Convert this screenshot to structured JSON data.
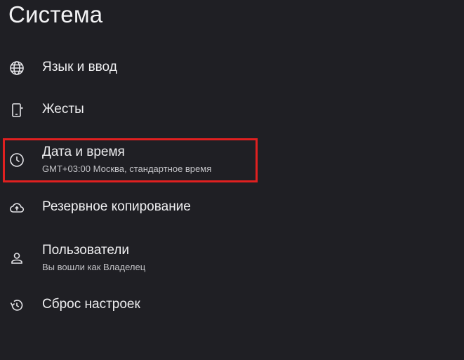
{
  "header": {
    "title": "Система"
  },
  "settings": {
    "items": [
      {
        "icon": "globe-icon",
        "label": "Язык и ввод",
        "summary": ""
      },
      {
        "icon": "gesture-phone-icon",
        "label": "Жесты",
        "summary": ""
      },
      {
        "icon": "clock-icon",
        "label": "Дата и время",
        "summary": "GMT+03:00 Москва, стандартное время"
      },
      {
        "icon": "cloud-upload-icon",
        "label": "Резервное копирование",
        "summary": ""
      },
      {
        "icon": "person-icon",
        "label": "Пользователи",
        "summary": "Вы вошли как Владелец"
      },
      {
        "icon": "restore-icon",
        "label": "Сброс настроек",
        "summary": ""
      }
    ]
  },
  "colors": {
    "background": "#1f1f24",
    "text_primary": "#eeeef0",
    "text_secondary": "#c4c4c8",
    "highlight_border": "#e02020"
  }
}
